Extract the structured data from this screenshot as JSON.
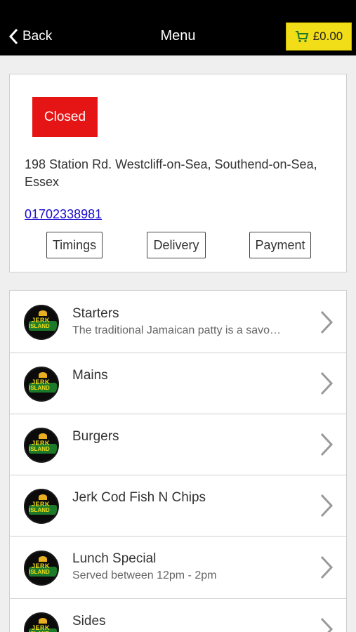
{
  "header": {
    "back_label": "Back",
    "title": "Menu",
    "cart_total": "£0.00"
  },
  "restaurant": {
    "status": "Closed",
    "address": "198 Station Rd. Westcliff-on-Sea, Southend-on-Sea, Essex",
    "phone": "01702338981",
    "buttons": {
      "timings": "Timings",
      "delivery": "Delivery",
      "payment": "Payment"
    }
  },
  "categories": [
    {
      "name": "Starters",
      "description": "The traditional Jamaican patty is a savo…"
    },
    {
      "name": "Mains",
      "description": ""
    },
    {
      "name": "Burgers",
      "description": ""
    },
    {
      "name": "Jerk Cod Fish N Chips",
      "description": ""
    },
    {
      "name": "Lunch Special",
      "description": "Served between 12pm - 2pm"
    },
    {
      "name": "Sides",
      "description": ""
    }
  ],
  "logo_text": {
    "line1": "JERK",
    "line2": "ISLAND"
  },
  "colors": {
    "header_bg": "#000000",
    "cart_bg": "#f2dd19",
    "status_closed": "#e61515",
    "link": "#1a0dcc"
  }
}
